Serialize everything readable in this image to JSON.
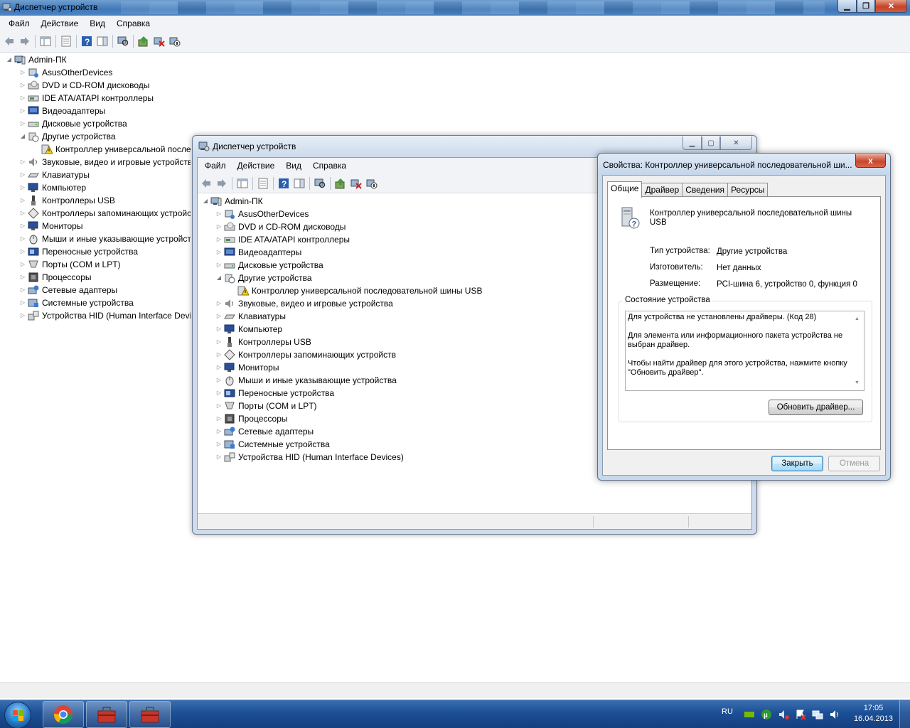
{
  "main_window": {
    "title": "Диспетчер устройств",
    "menu": [
      "Файл",
      "Действие",
      "Вид",
      "Справка"
    ],
    "tree": [
      {
        "label": "Admin-ПК",
        "level": 0,
        "expander": "open",
        "icon": "computer-icon"
      },
      {
        "label": "AsusOtherDevices",
        "level": 1,
        "expander": "closed",
        "icon": "device-icon"
      },
      {
        "label": "DVD и CD-ROM дисководы",
        "level": 1,
        "expander": "closed",
        "icon": "dvd-drive-icon"
      },
      {
        "label": "IDE ATA/ATAPI контроллеры",
        "level": 1,
        "expander": "closed",
        "icon": "ide-controller-icon"
      },
      {
        "label": "Видеоадаптеры",
        "level": 1,
        "expander": "closed",
        "icon": "display-adapter-icon"
      },
      {
        "label": "Дисковые устройства",
        "level": 1,
        "expander": "closed",
        "icon": "disk-drive-icon"
      },
      {
        "label": "Другие устройства",
        "level": 1,
        "expander": "open",
        "icon": "other-devices-icon"
      },
      {
        "label": "Контроллер универсальной последовательной шины USB",
        "level": 2,
        "expander": "none",
        "icon": "warning-device-icon"
      },
      {
        "label": "Звуковые, видео и игровые устройства",
        "level": 1,
        "expander": "closed",
        "icon": "sound-icon"
      },
      {
        "label": "Клавиатуры",
        "level": 1,
        "expander": "closed",
        "icon": "keyboard-icon"
      },
      {
        "label": "Компьютер",
        "level": 1,
        "expander": "closed",
        "icon": "monitor-icon"
      },
      {
        "label": "Контроллеры USB",
        "level": 1,
        "expander": "closed",
        "icon": "usb-icon"
      },
      {
        "label": "Контроллеры запоминающих устройств",
        "level": 1,
        "expander": "closed",
        "icon": "storage-controller-icon"
      },
      {
        "label": "Мониторы",
        "level": 1,
        "expander": "closed",
        "icon": "monitor-icon"
      },
      {
        "label": "Мыши и иные указывающие устройства",
        "level": 1,
        "expander": "closed",
        "icon": "mouse-icon"
      },
      {
        "label": "Переносные устройства",
        "level": 1,
        "expander": "closed",
        "icon": "portable-device-icon"
      },
      {
        "label": "Порты (COM и LPT)",
        "level": 1,
        "expander": "closed",
        "icon": "port-icon"
      },
      {
        "label": "Процессоры",
        "level": 1,
        "expander": "closed",
        "icon": "processor-icon"
      },
      {
        "label": "Сетевые адаптеры",
        "level": 1,
        "expander": "closed",
        "icon": "network-icon"
      },
      {
        "label": "Системные устройства",
        "level": 1,
        "expander": "closed",
        "icon": "system-device-icon"
      },
      {
        "label": "Устройства HID (Human Interface Devices)",
        "level": 1,
        "expander": "closed",
        "icon": "hid-icon"
      }
    ]
  },
  "second_window": {
    "title": "Диспетчер устройств",
    "menu": [
      "Файл",
      "Действие",
      "Вид",
      "Справка"
    ]
  },
  "dialog": {
    "title": "Свойства: Контроллер универсальной последовательной ши...",
    "close_label": "x",
    "tabs": [
      "Общие",
      "Драйвер",
      "Сведения",
      "Ресурсы"
    ],
    "device_name": "Контроллер универсальной последовательной шины USB",
    "props": [
      {
        "label": "Тип устройства:",
        "value": "Другие устройства"
      },
      {
        "label": "Изготовитель:",
        "value": "Нет данных"
      },
      {
        "label": "Размещение:",
        "value": "PCI-шина 6, устройство 0, функция 0"
      }
    ],
    "status_group_label": "Состояние устройства",
    "status_lines": [
      "Для устройства не установлены драйверы. (Код 28)",
      "Для элемента или информационного пакета устройства не выбран драйвер.",
      "Чтобы найти драйвер для этого устройства, нажмите кнопку \"Обновить драйвер\"."
    ],
    "update_driver_label": "Обновить драйвер...",
    "close_button_label": "Закрыть",
    "cancel_button_label": "Отмена"
  },
  "taskbar": {
    "language": "RU",
    "time": "17:05",
    "date": "16.04.2013"
  },
  "colors": {
    "titlebar_blue": "#4f86c4",
    "taskbar_blue": "#1c4f96",
    "close_red": "#c8472c"
  }
}
